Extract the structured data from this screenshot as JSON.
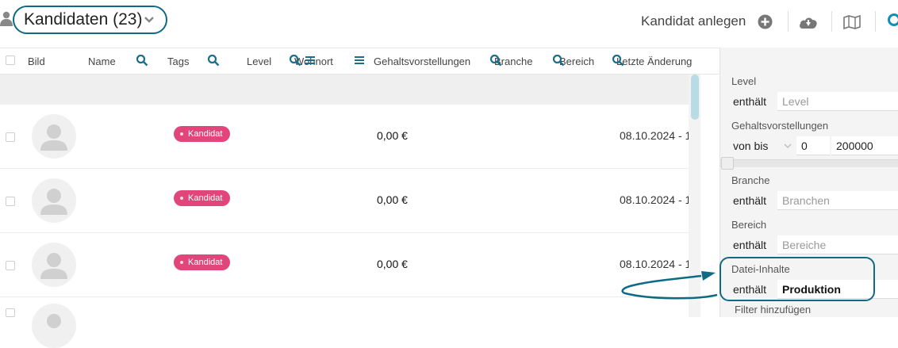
{
  "header": {
    "title": "Kandidaten (23)",
    "create_label": "Kandidat anlegen",
    "icons": [
      "users-icon",
      "chevron-down-icon",
      "plus-circle-icon",
      "cloud-download-icon",
      "map-icon",
      "search-icon"
    ]
  },
  "columns": {
    "bild": "Bild",
    "name": "Name",
    "tags": "Tags",
    "level": "Level",
    "wohnort": "Wohnort",
    "gehalt": "Gehaltsvorstellungen",
    "branche": "Branche",
    "bereich": "Bereich",
    "letzte": "Letzte Änderung"
  },
  "rows": [
    {
      "tag": "Kandidat",
      "salary": "0,00 €",
      "date": "08.10.2024 - 1"
    },
    {
      "tag": "Kandidat",
      "salary": "0,00 €",
      "date": "08.10.2024 - 1"
    },
    {
      "tag": "Kandidat",
      "salary": "0,00 €",
      "date": "08.10.2024 - 1"
    }
  ],
  "filters": {
    "level": {
      "label": "Level",
      "operator": "enthält",
      "placeholder": "Level"
    },
    "gehalt": {
      "label": "Gehaltsvorstellungen",
      "operator": "von bis",
      "min": "0",
      "max": "200000"
    },
    "branche": {
      "label": "Branche",
      "operator": "enthält",
      "placeholder": "Branchen"
    },
    "bereich": {
      "label": "Bereich",
      "operator": "enthält",
      "placeholder": "Bereiche"
    },
    "datei": {
      "label": "Datei-Inhalte",
      "operator": "enthält",
      "value": "Produktion"
    },
    "add_label": "Filter hinzufügen"
  },
  "colors": {
    "accent": "#0f6a86",
    "tag": "#e2457a",
    "panel_bg": "#f4f4f4"
  }
}
